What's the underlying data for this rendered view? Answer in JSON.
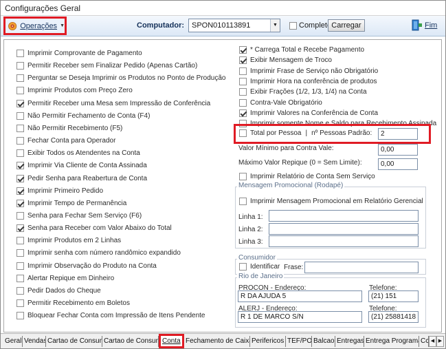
{
  "window": {
    "title": "Configurações Geral"
  },
  "toolbar": {
    "operacoes_label": "Operações",
    "computador_label": "Computador:",
    "computador_value": "SPON010113891",
    "completo_label": "Completo",
    "completo_checked": false,
    "carregar_label": "Carregar",
    "fim_label": "Fim"
  },
  "left_options": [
    {
      "label": "Imprimir Comprovante de Pagamento",
      "checked": false
    },
    {
      "label": "Permitir Receber sem Finalizar Pedido (Apenas Cartão)",
      "checked": false
    },
    {
      "label": "Perguntar se Deseja Imprimir os Produtos no Ponto de Produção",
      "checked": false
    },
    {
      "label": "Imprimir Produtos com Preço Zero",
      "checked": false
    },
    {
      "label": "Permitir Receber uma Mesa sem Impressão de Conferência",
      "checked": true
    },
    {
      "label": "Não Permitir Fechamento de Conta (F4)",
      "checked": false
    },
    {
      "label": "Não Permitir Recebimento (F5)",
      "checked": false
    },
    {
      "label": "Fechar Conta para Operador",
      "checked": false
    },
    {
      "label": "Exibir Todos os Atendentes na Conta",
      "checked": false
    },
    {
      "label": "Imprimir Via Cliente de Conta Assinada",
      "checked": true
    },
    {
      "label": "Pedir Senha para Reabertura de Conta",
      "checked": true
    },
    {
      "label": "Imprimir Primeiro Pedido",
      "checked": true
    },
    {
      "label": "Imprimir Tempo de Permanência",
      "checked": true
    },
    {
      "label": "Senha para Fechar Sem Serviço (F6)",
      "checked": false
    },
    {
      "label": "Senha para Receber com Valor Abaixo do Total",
      "checked": true
    },
    {
      "label": "Imprimir Produtos em 2 Linhas",
      "checked": false
    },
    {
      "label": "Imprimir senha com número randômico expandido",
      "checked": false
    },
    {
      "label": "Imprimir Observação do Produto na Conta",
      "checked": false
    },
    {
      "label": "Alertar Repique em Dinheiro",
      "checked": false
    },
    {
      "label": "Pedir Dados do Cheque",
      "checked": false
    },
    {
      "label": "Permitir Recebimento em Boletos",
      "checked": false
    },
    {
      "label": "Bloquear Fechar Conta com Impressão de Itens Pendente",
      "checked": false
    }
  ],
  "right_options": [
    {
      "label": "* Carrega Total e Recebe Pagamento",
      "checked": true
    },
    {
      "label": "Exibir Mensagem de Troco",
      "checked": true
    },
    {
      "label": "Imprimir Frase de Serviço não Obrigatório",
      "checked": false
    },
    {
      "label": "Imprimir Hora na conferência de produtos",
      "checked": false
    },
    {
      "label": "Exibir Frações (1/2, 1/3, 1/4) na Conta",
      "checked": false
    },
    {
      "label": "Contra-Vale Obrigatório",
      "checked": false
    },
    {
      "label": "Imprimir Valores na Conferência de Conta",
      "checked": true
    },
    {
      "label": "Imprimir somente Nome e Saldo para Recebimento Assinada",
      "checked": false
    }
  ],
  "total_pessoa": {
    "label": "Total por Pessoa",
    "separator": "|",
    "padrao_label": "nº Pessoas Padrão:",
    "padrao_value": "2",
    "checked": false
  },
  "valor_minimo": {
    "label": "Valor Mínimo para Contra Vale:",
    "value": "0,00"
  },
  "valor_repique": {
    "label": "Máximo Valor Repique (0 = Sem Limite):",
    "value": "0,00"
  },
  "relatorio_sem_servico": {
    "label": "Imprimir Relatório de Conta Sem Serviço",
    "checked": false
  },
  "mensagem_promocional": {
    "title": "Mensagem Promocional (Rodapé)",
    "checkbox_label": "Imprimir Mensagem Promocional em Relatório Gerencial",
    "checked": false,
    "linha1_label": "Linha 1:",
    "linha2_label": "Linha 2:",
    "linha3_label": "Linha 3:",
    "linha1_value": "",
    "linha2_value": "",
    "linha3_value": ""
  },
  "consumidor": {
    "title": "Consumidor",
    "identificar_label": "Identificar",
    "identificar_checked": false,
    "frase_label": "Frase:",
    "frase_value": ""
  },
  "rio": {
    "title": "Rio de Janeiro",
    "procon_label": "PROCON - Endereço:",
    "procon_value": "R DA AJUDA 5",
    "procon_tel_label": "Telefone:",
    "procon_tel_value": "(21) 151",
    "alerj_label": "ALERJ - Endereço:",
    "alerj_value": "R 1 DE MARCO S/N",
    "alerj_tel_label": "Telefone:",
    "alerj_tel_value": "(21) 25881418"
  },
  "tabs": [
    {
      "label": "Geral"
    },
    {
      "label": "Vendas"
    },
    {
      "label": "Cartao de Consumo"
    },
    {
      "label": "Cartao de Consumo"
    },
    {
      "label": "Conta",
      "active": true
    },
    {
      "label": "Fechamento de Caixa"
    },
    {
      "label": "Perifericos"
    },
    {
      "label": "TEF/POS"
    },
    {
      "label": "Balcao"
    },
    {
      "label": "Entregas"
    },
    {
      "label": "Entrega Programada"
    },
    {
      "label": "Cc"
    }
  ],
  "colors": {
    "highlight": "#e01b24",
    "toolbar_start": "#f4f8fd",
    "toolbar_end": "#dce8f6"
  }
}
